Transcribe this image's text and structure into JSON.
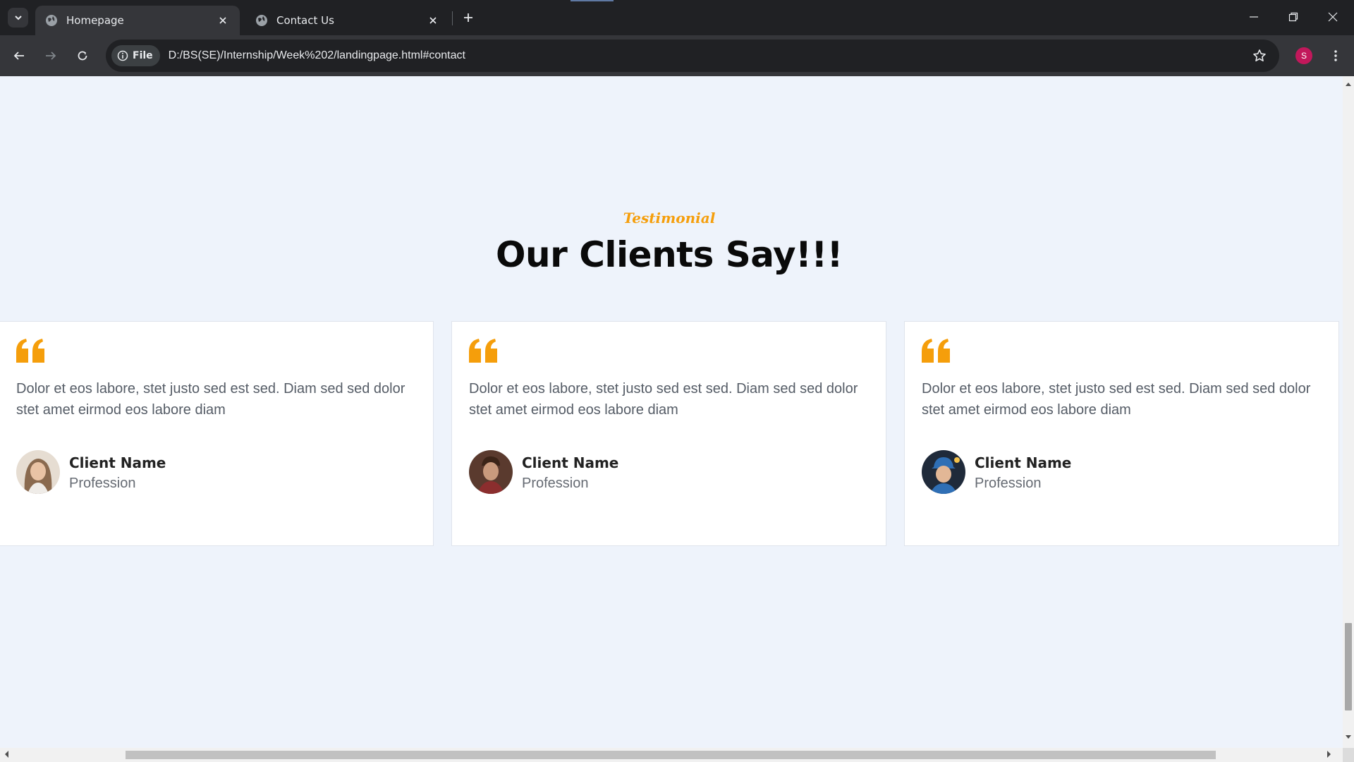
{
  "browser": {
    "tabs": [
      {
        "title": "Homepage",
        "active": true
      },
      {
        "title": "Contact Us",
        "active": false
      }
    ],
    "chip_label": "File",
    "url": "D:/BS(SE)/Internship/Week%202/landingpage.html#contact",
    "profile_initial": "S",
    "colors": {
      "frame": "#202124",
      "toolbar": "#35363a",
      "profile": "#c2185b"
    },
    "icons": [
      "tab-search-icon",
      "globe-icon",
      "close-icon",
      "plus-icon",
      "minimize-icon",
      "restore-icon",
      "back-arrow-icon",
      "forward-arrow-icon",
      "reload-icon",
      "info-icon",
      "star-icon",
      "kebab-menu-icon"
    ]
  },
  "page": {
    "background": "#eef3fb",
    "accent": "#f59e0b",
    "eyebrow": "Testimonial",
    "title": "Our Clients Say!!!",
    "testimonials": [
      {
        "text": "Dolor et eos labore, stet justo sed est sed. Diam sed sed dolor stet amet eirmod eos labore diam",
        "name": "Client Name",
        "profession": "Profession",
        "avatar": "woman-with-long-hair"
      },
      {
        "text": "Dolor et eos labore, stet justo sed est sed. Diam sed sed dolor stet amet eirmod eos labore diam",
        "name": "Client Name",
        "profession": "Profession",
        "avatar": "man-with-dark-hair"
      },
      {
        "text": "Dolor et eos labore, stet justo sed est sed. Diam sed sed dolor stet amet eirmod eos labore diam",
        "name": "Client Name",
        "profession": "Profession",
        "avatar": "man-in-blue-cap"
      }
    ]
  }
}
